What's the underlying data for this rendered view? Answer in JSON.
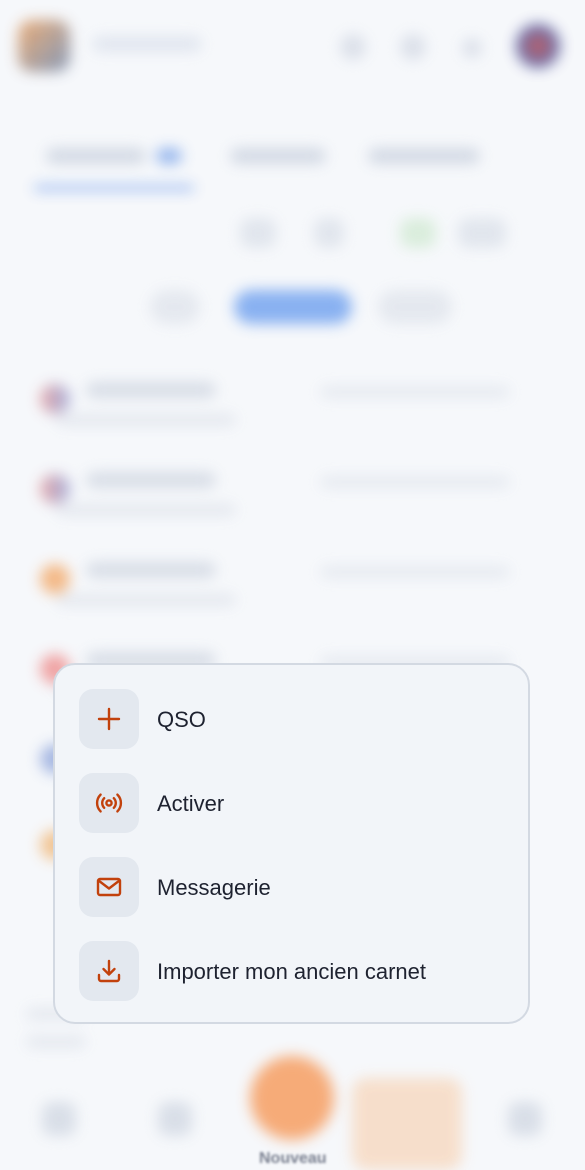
{
  "fab_label": "Nouveau",
  "accent_color": "#c2410c",
  "menu": {
    "items": [
      {
        "label": "QSO",
        "icon": "plus-icon"
      },
      {
        "label": "Activer",
        "icon": "broadcast-icon"
      },
      {
        "label": "Messagerie",
        "icon": "mail-icon"
      },
      {
        "label": "Importer mon ancien carnet",
        "icon": "download-icon"
      }
    ]
  }
}
